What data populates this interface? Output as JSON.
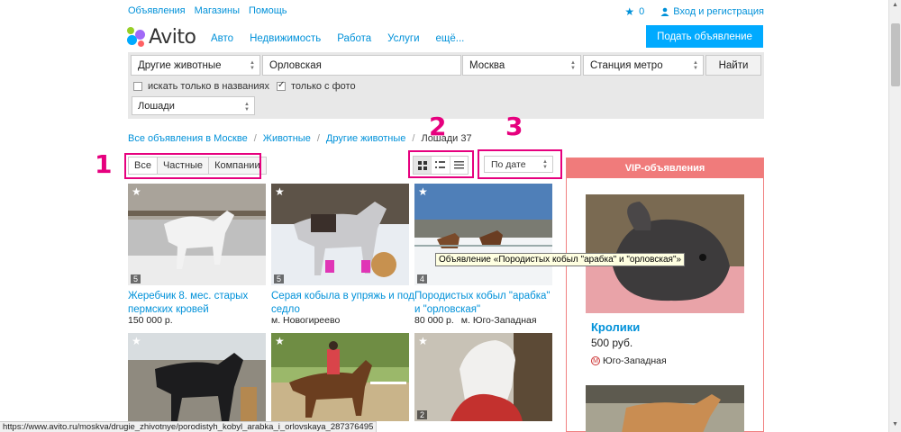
{
  "topbar": {
    "ads": "Объявления",
    "shops": "Магазины",
    "help": "Помощь",
    "fav_count": "0",
    "login": "Вход и регистрация"
  },
  "logo": {
    "text": "Avito"
  },
  "nav": {
    "auto": "Авто",
    "realty": "Недвижимость",
    "job": "Работа",
    "services": "Услуги",
    "more": "ещё..."
  },
  "post_button": "Подать объявление",
  "search": {
    "category": "Другие животные",
    "query": "Орловская",
    "city": "Москва",
    "metro": "Станция метро",
    "find": "Найти",
    "titles_only": "искать только в названиях",
    "titles_only_checked": false,
    "with_photo": "только с фото",
    "with_photo_checked": true,
    "subcategory": "Лошади"
  },
  "breadcrumb": {
    "all": "Все объявления в Москве",
    "animals": "Животные",
    "other": "Другие животные",
    "current": "Лошади 37"
  },
  "filters": {
    "all": "Все",
    "private": "Частные",
    "companies": "Компании"
  },
  "sort": {
    "value": "По дате"
  },
  "annotations": {
    "n1": "1",
    "n2": "2",
    "n3": "3",
    "color": "#e6007e"
  },
  "listings": [
    {
      "title": "Жеребчик 8. мес. старых пермских кровей",
      "price": "150 000 р.",
      "location": "",
      "photos": "5"
    },
    {
      "title": "Серая кобыла в упряжь и под седло",
      "price": "",
      "location": "м. Новогиреево",
      "photos": "5"
    },
    {
      "title": "Породистых кобыл \"арабка\" и \"орловская\"",
      "price": "80 000 р.",
      "location": "м. Юго-Западная",
      "photos": "4"
    },
    {
      "title": "",
      "price": "",
      "location": "",
      "photos": ""
    },
    {
      "title": "",
      "price": "",
      "location": "",
      "photos": ""
    },
    {
      "title": "",
      "price": "",
      "location": "",
      "photos": "2"
    }
  ],
  "tooltip": "Объявление «Породистых кобыл \"арабка\" и \"орловская\"»",
  "vip": {
    "header": "VIP-объявления",
    "title": "Кролики",
    "price": "500 руб.",
    "metro_icon": "М",
    "metro": "Юго-Западная"
  },
  "status_url": "https://www.avito.ru/moskva/drugie_zhivotnye/porodistyh_kobyl_arabka_i_orlovskaya_287376495",
  "colors": {
    "accent": "#00aaff",
    "link": "#0091d9",
    "vip": "#f07b7b"
  }
}
